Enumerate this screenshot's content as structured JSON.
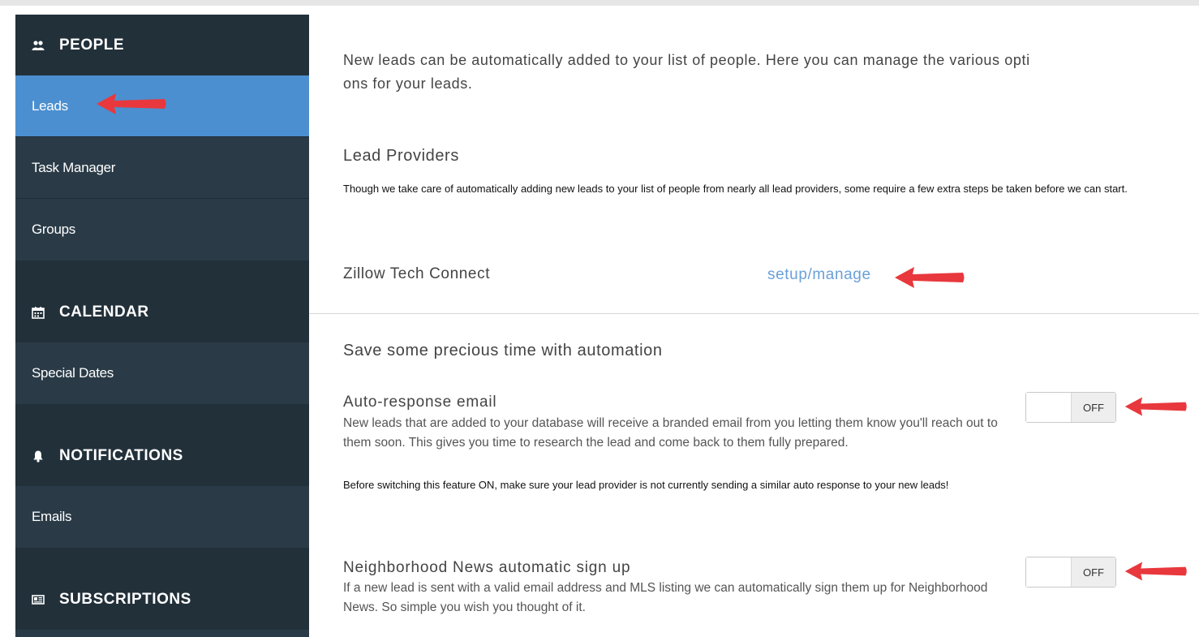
{
  "sidebar": {
    "people": {
      "heading": "PEOPLE",
      "icon": "users-icon",
      "items": [
        {
          "label": "Leads",
          "active": true
        },
        {
          "label": "Task Manager",
          "active": false
        },
        {
          "label": "Groups",
          "active": false
        }
      ]
    },
    "calendar": {
      "heading": "CALENDAR",
      "icon": "calendar-icon",
      "items": [
        {
          "label": "Special Dates"
        }
      ]
    },
    "notifications": {
      "heading": "NOTIFICATIONS",
      "icon": "bell-icon",
      "items": [
        {
          "label": "Emails"
        }
      ]
    },
    "subscriptions": {
      "heading": "SUBSCRIPTIONS",
      "icon": "newspaper-icon"
    }
  },
  "main": {
    "intro_line1": "New leads can be automatically added to your list of people. Here you can manage the various opti",
    "intro_line2": "ons for your leads.",
    "lead_providers": {
      "heading": "Lead Providers",
      "note": "Though we take care of automatically adding new leads to your list of people from nearly all lead providers, some require a few extra steps be taken before we can start.",
      "provider_name": "Zillow Tech Connect",
      "provider_link": "setup/manage"
    },
    "automation": {
      "heading": "Save some precious time with automation",
      "auto_response": {
        "label": "Auto-response email",
        "description": "New leads that are added to your database will receive a branded email from you letting them know you'll reach out to them soon. This gives you time to research the lead and come back to them fully prepared.",
        "warning": "Before switching this feature ON, make sure your lead provider is not currently sending a similar auto response to your new leads!",
        "toggle_state": "OFF"
      },
      "neighborhood_news": {
        "label": "Neighborhood News automatic sign up",
        "description": "If a new lead is sent with a valid email address and MLS listing we can automatically sign them up for Neighborhood News. So simple you wish you thought of it.",
        "toggle_state": "OFF"
      }
    }
  },
  "colors": {
    "sidebar_bg": "#2a3b47",
    "sidebar_heading_bg": "#22303a",
    "active_item": "#4b8fd0",
    "link": "#6aa0d8",
    "annotation_arrow": "#e8383d"
  }
}
